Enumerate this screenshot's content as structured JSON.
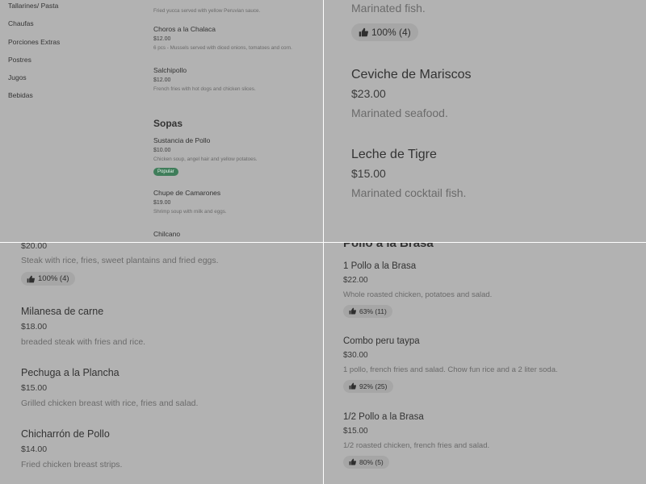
{
  "categories": [
    "Tallarines/ Pasta",
    "Chaufas",
    "Porciones Extras",
    "Postres",
    "Jugos",
    "Bebidas"
  ],
  "small_menu": {
    "top_item_desc": "Fried yucca served with yellow Peruvian sauce.",
    "items": [
      {
        "name": "Choros a la Chalaca",
        "price": "$12.00",
        "desc": "6 pcs - Mussels served with diced onions, tomatoes and corn."
      },
      {
        "name": "Salchipollo",
        "price": "$12.00",
        "desc": "French fries with hot dogs and chicken slices."
      }
    ],
    "soup_section": "Sopas",
    "soups": [
      {
        "name": "Sustancia de Pollo",
        "price": "$10.00",
        "desc": "Chicken soup, angel hair and yellow potatoes.",
        "badge": "Popular"
      },
      {
        "name": "Chupe de Camarones",
        "price": "$19.00",
        "desc": "Shrimp soup with milk and eggs."
      },
      {
        "name": "Chilcano",
        "price": "",
        "desc": ""
      }
    ]
  },
  "large_view": {
    "top_desc": "Marinated fish.",
    "top_badge": "100% (4)",
    "items": [
      {
        "name": "Ceviche de Mariscos",
        "price": "$23.00",
        "desc": "Marinated seafood."
      },
      {
        "name": "Leche de Tigre",
        "price": "$15.00",
        "desc": "Marinated cocktail fish."
      }
    ]
  },
  "steak_view": {
    "top_price": "$20.00",
    "top_desc": "Steak with rice, fries, sweet plantains and fried eggs.",
    "top_badge": "100% (4)",
    "items": [
      {
        "name": "Milanesa de carne",
        "price": "$18.00",
        "desc": "breaded steak with fries and rice."
      },
      {
        "name": "Pechuga a la Plancha",
        "price": "$15.00",
        "desc": "Grilled chicken breast with rice, fries and salad."
      },
      {
        "name": "Chicharrón de Pollo",
        "price": "$14.00",
        "desc": "Fried chicken breast strips."
      }
    ]
  },
  "chicken_view": {
    "section": "Pollo a la Brasa",
    "items": [
      {
        "name": "1 Pollo a la Brasa",
        "price": "$22.00",
        "desc": "Whole roasted chicken, potatoes and salad.",
        "badge": "63% (11)"
      },
      {
        "name": "Combo peru taypa",
        "price": "$30.00",
        "desc": "1 pollo, french fries and salad. Chow fun rice and a 2 liter soda.",
        "badge": "92% (25)"
      },
      {
        "name": "1/2 Pollo a la Brasa",
        "price": "$15.00",
        "desc": "1/2 roasted chicken, french fries and salad.",
        "badge": "80% (5)"
      }
    ]
  },
  "colors": {
    "overlay": "#b2b2b2",
    "divider": "#ffffff",
    "popular_badge": "#3f7d5a",
    "rating_badge": "#a6a6a6"
  }
}
